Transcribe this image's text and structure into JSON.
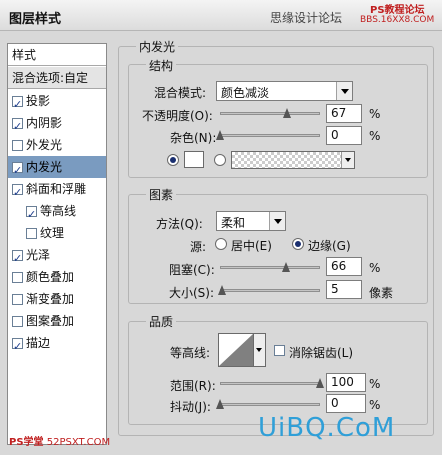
{
  "window": {
    "title": "图层样式",
    "forum": "思缘设计论坛",
    "watermark_top1": "PS教程论坛",
    "watermark_top2": "BBS.16XX8.COM"
  },
  "left_panel": {
    "header": "样式",
    "blend_options": "混合选项:自定",
    "items": [
      {
        "label": "投影",
        "checked": true
      },
      {
        "label": "内阴影",
        "checked": true
      },
      {
        "label": "外发光",
        "checked": false
      },
      {
        "label": "内发光",
        "checked": true,
        "selected": true
      },
      {
        "label": "斜面和浮雕",
        "checked": true
      },
      {
        "label": "等高线",
        "checked": true,
        "sub": true
      },
      {
        "label": "纹理",
        "checked": false,
        "sub": true
      },
      {
        "label": "光泽",
        "checked": true
      },
      {
        "label": "颜色叠加",
        "checked": false
      },
      {
        "label": "渐变叠加",
        "checked": false
      },
      {
        "label": "图案叠加",
        "checked": false
      },
      {
        "label": "描边",
        "checked": true
      }
    ]
  },
  "inner_glow": {
    "title": "内发光",
    "structure": {
      "title": "结构",
      "blend_mode_label": "混合模式:",
      "blend_mode_value": "颜色减淡",
      "opacity_label": "不透明度(O):",
      "opacity_value": "67",
      "opacity_fraction": 0.67,
      "opacity_unit": "%",
      "noise_label": "杂色(N):",
      "noise_value": "0",
      "noise_fraction": 0.0,
      "noise_unit": "%",
      "color_selected": "solid",
      "color_hex": "#ffffff"
    },
    "elements": {
      "title": "图素",
      "technique_label": "方法(Q):",
      "technique_value": "柔和",
      "source_label": "源:",
      "source_center": "居中(E)",
      "source_edge": "边缘(G)",
      "source_selected": "edge",
      "choke_label": "阻塞(C):",
      "choke_value": "66",
      "choke_fraction": 0.66,
      "choke_unit": "%",
      "size_label": "大小(S):",
      "size_value": "5",
      "size_fraction": 0.02,
      "size_unit": "像素"
    },
    "quality": {
      "title": "品质",
      "contour_label": "等高线:",
      "antialias_label": "消除锯齿(L)",
      "antialias_checked": false,
      "range_label": "范围(R):",
      "range_value": "100",
      "range_fraction": 1.0,
      "range_unit": "%",
      "jitter_label": "抖动(J):",
      "jitter_value": "0",
      "jitter_fraction": 0.0,
      "jitter_unit": "%"
    }
  },
  "watermarks": {
    "bottom_left_ps": "PS学堂",
    "bottom_left_url": "52PSXT.COM",
    "bottom_right": "UiBQ.CoM"
  },
  "colors": {
    "selection": "#7a9bc0",
    "panel_bg": "#d8d8d8",
    "watermark_blue": "#2f9fd8",
    "watermark_red": "#c02020"
  }
}
